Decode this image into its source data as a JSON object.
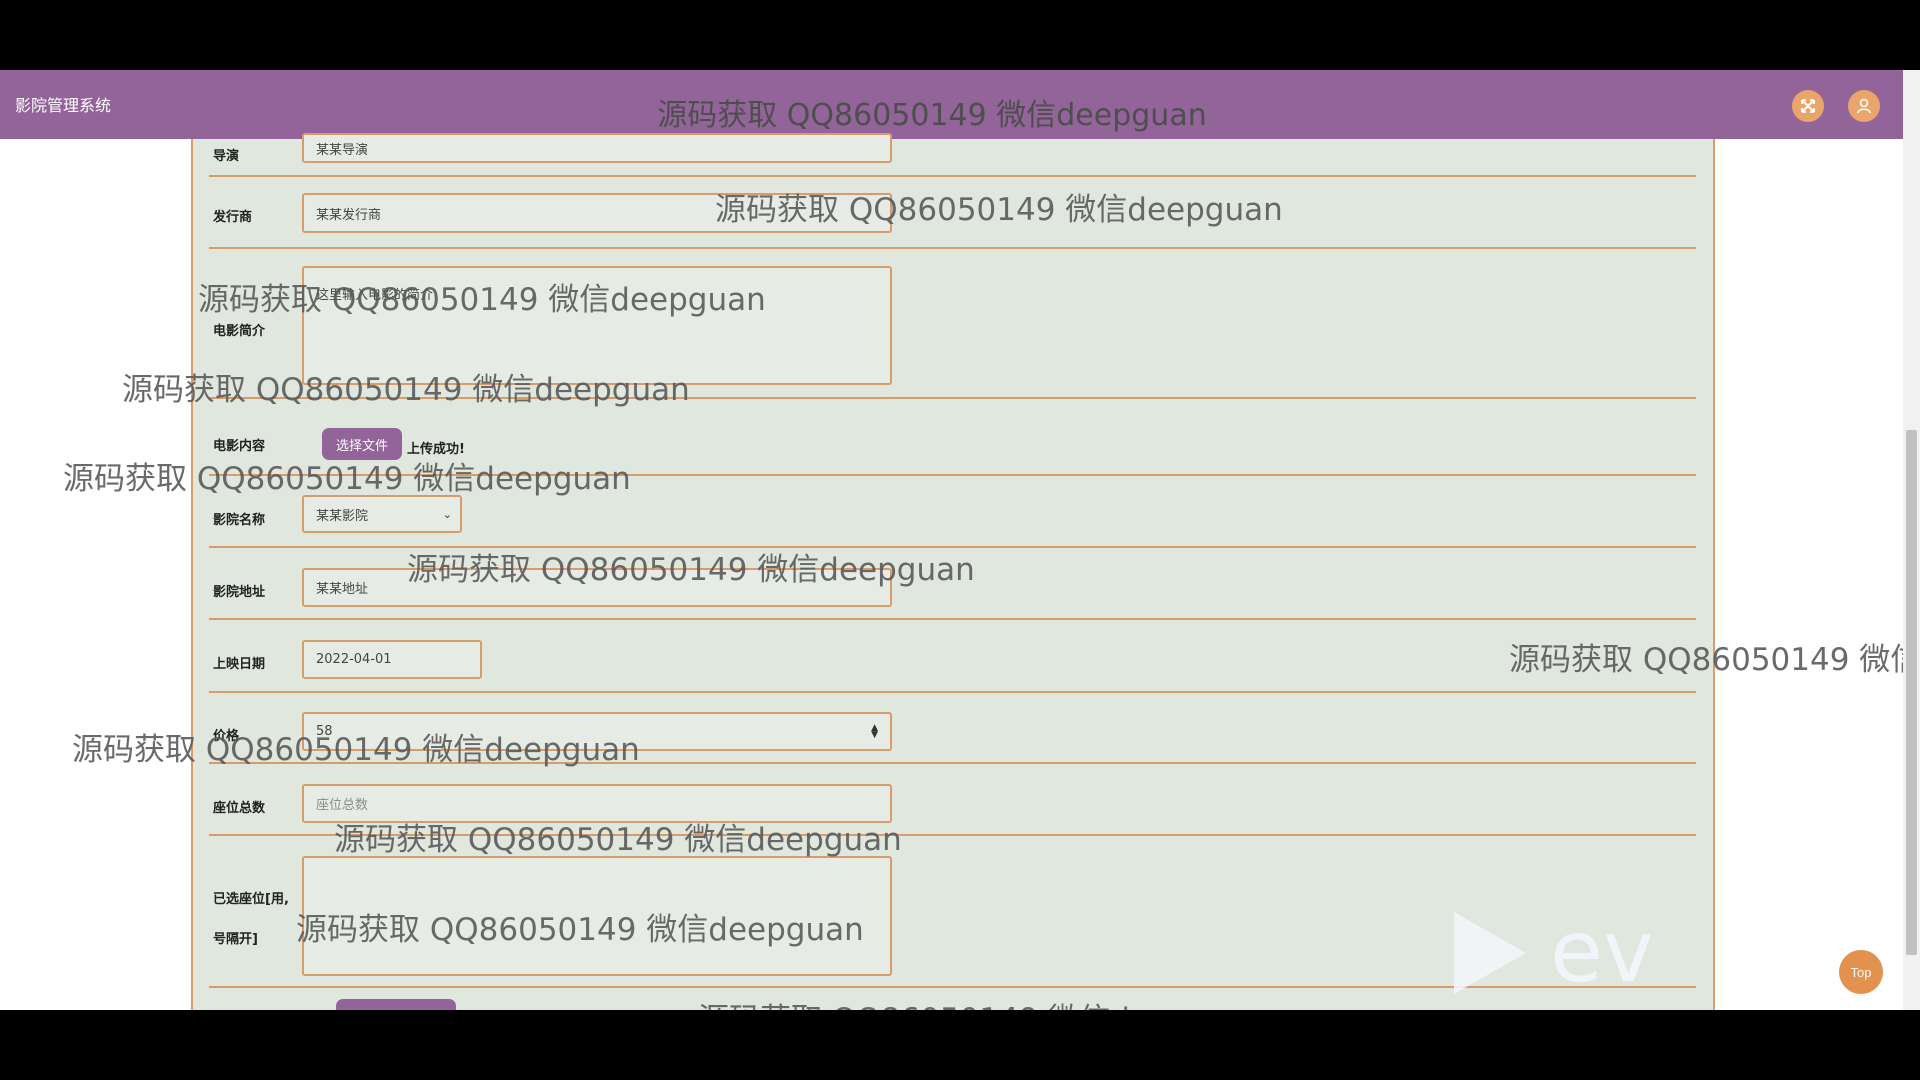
{
  "header": {
    "brand": "影院管理系统",
    "watermark_title": "源码获取 QQ86050149 微信deepguan",
    "fullscreen_icon": "expand-icon",
    "user_icon": "user-icon"
  },
  "form": {
    "director": {
      "label": "导演",
      "value": "某某导演"
    },
    "distributor": {
      "label": "发行商",
      "value": "某某发行商"
    },
    "synopsis": {
      "label": "电影简介",
      "value": "这里输入电影的简介"
    },
    "content": {
      "label": "电影内容",
      "button": "选择文件",
      "status": "上传成功!"
    },
    "cinema_name": {
      "label": "影院名称",
      "selected": "某某影院"
    },
    "cinema_address": {
      "label": "影院地址",
      "value": "某某地址"
    },
    "release_date": {
      "label": "上映日期",
      "value": "2022-04-01"
    },
    "price": {
      "label": "价格",
      "value": "58"
    },
    "total_seats": {
      "label": "座位总数",
      "placeholder": "座位总数"
    },
    "selected_seats": {
      "label_line1": "已选座位[用,",
      "label_line2": "号隔开]"
    }
  },
  "watermark": "源码获取 QQ86050149 微信deepguan",
  "watermark_partial": "源码获取 QQ86050149 微信d",
  "top_button": "Top",
  "logo_text": "ev",
  "colors": {
    "header": "#93649a",
    "panel": "#dfe7df",
    "border": "#d89c6a",
    "accent": "#e2914e"
  }
}
